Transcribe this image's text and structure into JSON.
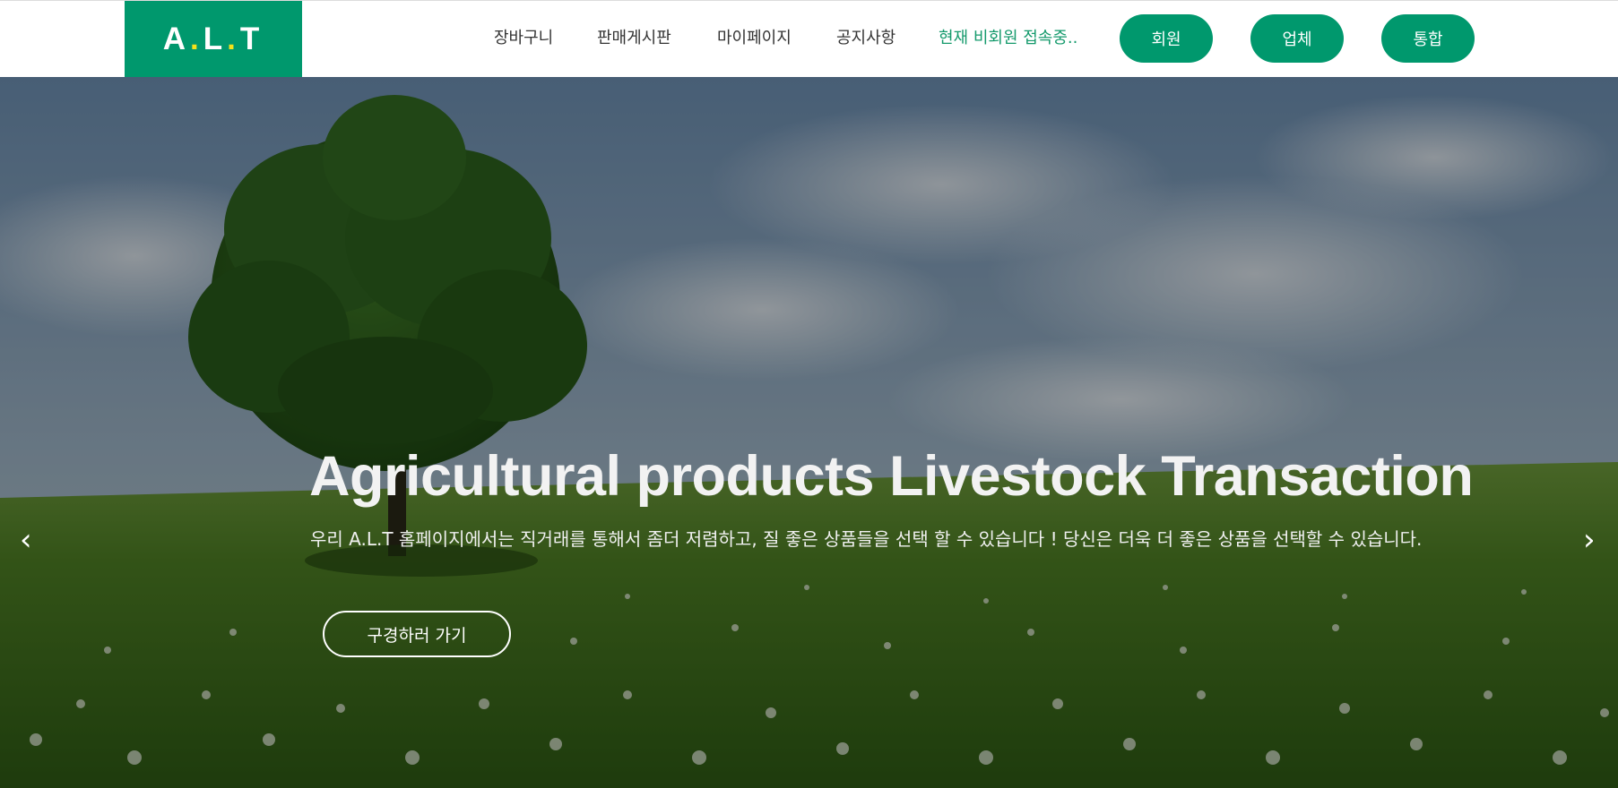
{
  "header": {
    "logo": {
      "parts": [
        "A",
        ".",
        "L",
        ".",
        "T"
      ]
    },
    "nav": [
      {
        "label": "장바구니"
      },
      {
        "label": "판매게시판"
      },
      {
        "label": "마이페이지"
      },
      {
        "label": "공지사항"
      }
    ],
    "status": "현재 비회원 접속중..",
    "buttons": [
      {
        "label": "회원"
      },
      {
        "label": "업체"
      },
      {
        "label": "통합"
      }
    ]
  },
  "hero": {
    "title": "Agricultural products Livestock Transaction",
    "subtitle": "우리 A.L.T 홈페이지에서는 직거래를 통해서 좀더 저렴하고, 질 좋은 상품들을 선택 할 수 있습니다 ! 당신은 더욱 더 좋은 상품을 선택할 수 있습니다.",
    "cta": "구경하러 가기",
    "prev_arrow": "‹",
    "next_arrow": "›"
  },
  "colors": {
    "brand": "#00986d",
    "logo_dot": "#f4e21a",
    "status_text": "#159a6c"
  }
}
